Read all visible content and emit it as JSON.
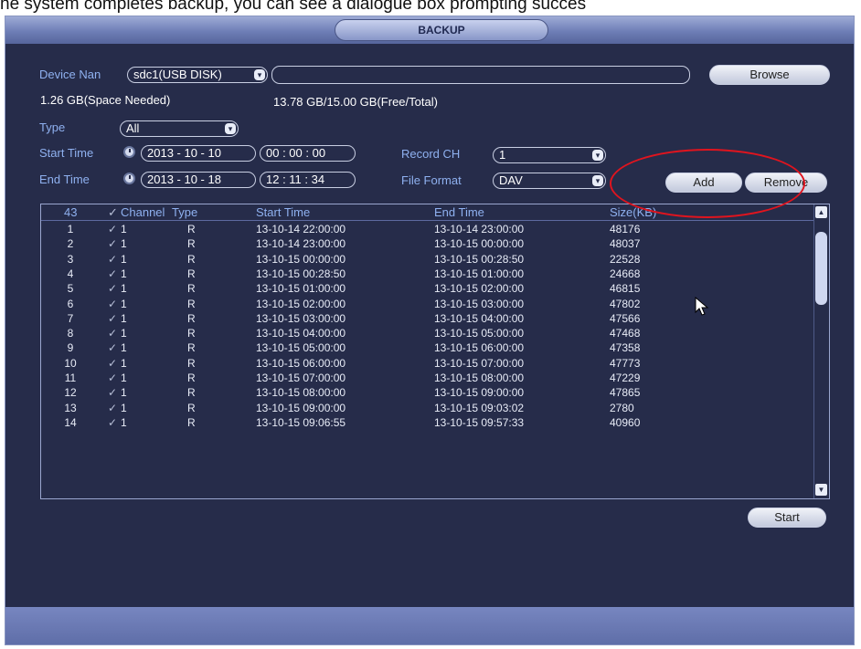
{
  "caption": "he system completes backup, you can see a dialogue box prompting succes",
  "window": {
    "title": "BACKUP"
  },
  "device": {
    "label": "Device Nan",
    "value": "sdc1(USB DISK)",
    "path": "",
    "browse": "Browse"
  },
  "space": {
    "needed": "1.26 GB(Space Needed)",
    "free_total": "13.78 GB/15.00 GB(Free/Total)"
  },
  "type": {
    "label": "Type",
    "value": "All"
  },
  "start_time": {
    "label": "Start Time",
    "date": "2013 - 10 - 10",
    "time": "00 : 00 : 00"
  },
  "end_time": {
    "label": "End Time",
    "date": "2013 - 10 - 18",
    "time": "12 : 11 : 34"
  },
  "record_ch": {
    "label": "Record CH",
    "value": "1"
  },
  "file_format": {
    "label": "File Format",
    "value": "DAV"
  },
  "buttons": {
    "add": "Add",
    "remove": "Remove",
    "start": "Start"
  },
  "table": {
    "headers": {
      "count": "43",
      "channel": "Channel",
      "type": "Type",
      "start": "Start Time",
      "end": "End Time",
      "size": "Size(KB)"
    },
    "rows": [
      {
        "n": "1",
        "ch": "1",
        "t": "R",
        "start": "13-10-14 22:00:00",
        "end": "13-10-14 23:00:00",
        "size": "48176"
      },
      {
        "n": "2",
        "ch": "1",
        "t": "R",
        "start": "13-10-14 23:00:00",
        "end": "13-10-15 00:00:00",
        "size": "48037"
      },
      {
        "n": "3",
        "ch": "1",
        "t": "R",
        "start": "13-10-15 00:00:00",
        "end": "13-10-15 00:28:50",
        "size": "22528"
      },
      {
        "n": "4",
        "ch": "1",
        "t": "R",
        "start": "13-10-15 00:28:50",
        "end": "13-10-15 01:00:00",
        "size": "24668"
      },
      {
        "n": "5",
        "ch": "1",
        "t": "R",
        "start": "13-10-15 01:00:00",
        "end": "13-10-15 02:00:00",
        "size": "46815"
      },
      {
        "n": "6",
        "ch": "1",
        "t": "R",
        "start": "13-10-15 02:00:00",
        "end": "13-10-15 03:00:00",
        "size": "47802"
      },
      {
        "n": "7",
        "ch": "1",
        "t": "R",
        "start": "13-10-15 03:00:00",
        "end": "13-10-15 04:00:00",
        "size": "47566"
      },
      {
        "n": "8",
        "ch": "1",
        "t": "R",
        "start": "13-10-15 04:00:00",
        "end": "13-10-15 05:00:00",
        "size": "47468"
      },
      {
        "n": "9",
        "ch": "1",
        "t": "R",
        "start": "13-10-15 05:00:00",
        "end": "13-10-15 06:00:00",
        "size": "47358"
      },
      {
        "n": "10",
        "ch": "1",
        "t": "R",
        "start": "13-10-15 06:00:00",
        "end": "13-10-15 07:00:00",
        "size": "47773"
      },
      {
        "n": "11",
        "ch": "1",
        "t": "R",
        "start": "13-10-15 07:00:00",
        "end": "13-10-15 08:00:00",
        "size": "47229"
      },
      {
        "n": "12",
        "ch": "1",
        "t": "R",
        "start": "13-10-15 08:00:00",
        "end": "13-10-15 09:00:00",
        "size": "47865"
      },
      {
        "n": "13",
        "ch": "1",
        "t": "R",
        "start": "13-10-15 09:00:00",
        "end": "13-10-15 09:03:02",
        "size": "2780"
      },
      {
        "n": "14",
        "ch": "1",
        "t": "R",
        "start": "13-10-15 09:06:55",
        "end": "13-10-15 09:57:33",
        "size": "40960"
      }
    ]
  },
  "icons": {
    "clock": "clock-icon",
    "check": "check-icon",
    "cursor": "mouse-pointer-icon",
    "dropdown": "chevron-down-icon"
  },
  "colors": {
    "background": "#262c4a",
    "label": "#8fb1f0",
    "annotation": "#e0141e"
  }
}
